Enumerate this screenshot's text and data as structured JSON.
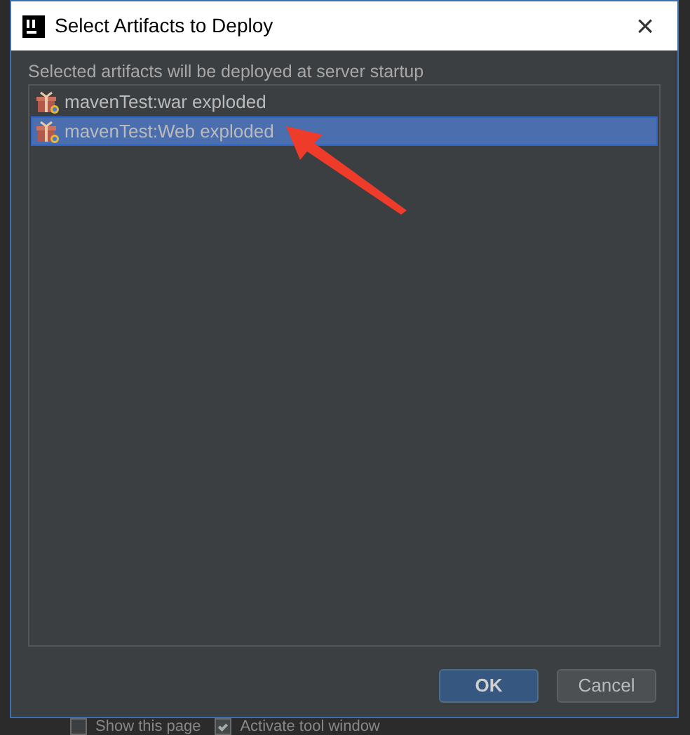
{
  "window": {
    "title": "Select Artifacts to Deploy",
    "close": "×"
  },
  "hint": "Selected artifacts will be deployed at server startup",
  "artifacts": [
    {
      "label": "mavenTest:war exploded",
      "selected": false
    },
    {
      "label": "mavenTest:Web exploded",
      "selected": true
    }
  ],
  "buttons": [
    {
      "label": "OK",
      "kind": "primary"
    },
    {
      "label": "Cancel",
      "kind": "secondary"
    }
  ],
  "background_options": [
    {
      "label": "Show this page",
      "checked": false
    },
    {
      "label": "Activate tool window",
      "checked": true
    }
  ]
}
